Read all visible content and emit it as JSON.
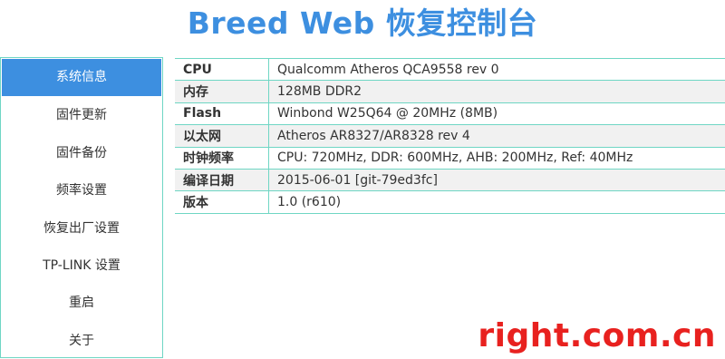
{
  "header": {
    "title": "Breed Web 恢复控制台"
  },
  "sidebar": {
    "items": [
      {
        "label": "系统信息",
        "active": true
      },
      {
        "label": "固件更新",
        "active": false
      },
      {
        "label": "固件备份",
        "active": false
      },
      {
        "label": "频率设置",
        "active": false
      },
      {
        "label": "恢复出厂设置",
        "active": false
      },
      {
        "label": "TP-LINK 设置",
        "active": false
      },
      {
        "label": "重启",
        "active": false
      },
      {
        "label": "关于",
        "active": false
      }
    ]
  },
  "system_info": {
    "rows": [
      {
        "key": "CPU",
        "value": "Qualcomm Atheros QCA9558 rev 0"
      },
      {
        "key": "内存",
        "value": "128MB DDR2"
      },
      {
        "key": "Flash",
        "value": "Winbond W25Q64 @ 20MHz (8MB)"
      },
      {
        "key": "以太网",
        "value": "Atheros AR8327/AR8328 rev 4"
      },
      {
        "key": "时钟频率",
        "value": "CPU: 720MHz, DDR: 600MHz, AHB: 200MHz, Ref: 40MHz"
      },
      {
        "key": "编译日期",
        "value": "2015-06-01 [git-79ed3fc]"
      },
      {
        "key": "版本",
        "value": "1.0 (r610)"
      }
    ]
  },
  "watermark": {
    "text": "right.com.cn"
  },
  "colors": {
    "accent": "#3d8fe0",
    "border": "#6fd6c4",
    "watermark": "#e8211f"
  }
}
